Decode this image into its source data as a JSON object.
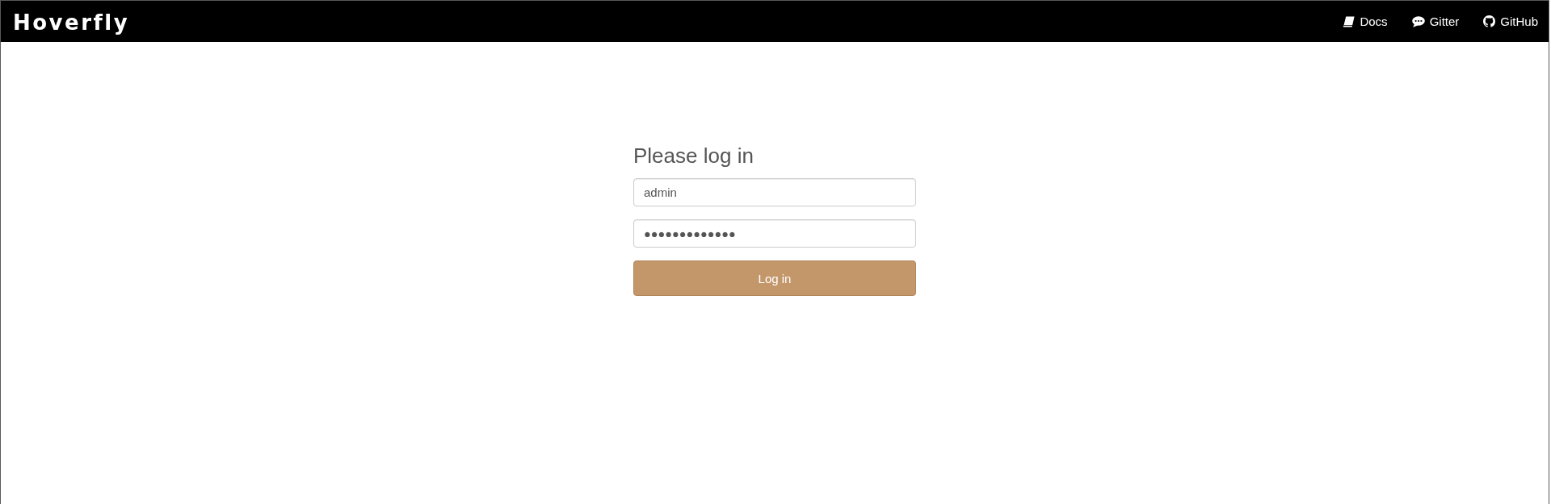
{
  "header": {
    "brand": "Hoverfly",
    "links": [
      {
        "kind": "book",
        "label": "Docs"
      },
      {
        "kind": "chat",
        "label": "Gitter"
      },
      {
        "kind": "github",
        "label": "GitHub"
      }
    ]
  },
  "login": {
    "title": "Please log in",
    "fields": [
      {
        "kind": "text",
        "value": "admin"
      },
      {
        "kind": "password",
        "value": "●●●●●●●●●●●●●"
      }
    ],
    "button": "Log in"
  }
}
